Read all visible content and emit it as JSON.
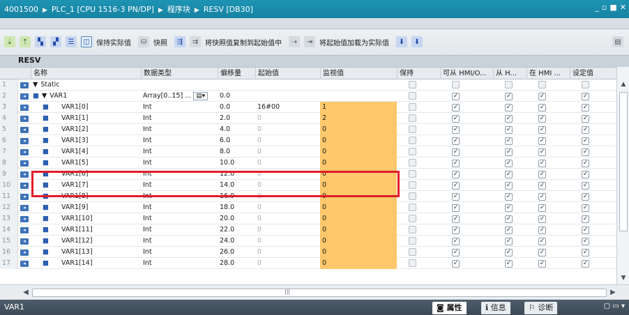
{
  "window": {
    "breadcrumb": [
      "4001500",
      "PLC_1 [CPU 1516-3 PN/DP]",
      "程序块",
      "RESV [DB30]"
    ],
    "controls": [
      "_",
      "▫",
      "■",
      "✕"
    ]
  },
  "toolbar": {
    "retain_label": "保持实际值",
    "snapshot_label": "快照",
    "copy_snapshot_label": "将快照值复制到起始值中",
    "load_start_label": "将起始值加载为实际值"
  },
  "block": {
    "name": "RESV"
  },
  "table": {
    "headers": [
      "名称",
      "数据类型",
      "偏移量",
      "起始值",
      "监视值",
      "保持",
      "可从 HMI/O...",
      "从 H...",
      "在 HMI ...",
      "设定值"
    ],
    "rows": [
      {
        "num": "1",
        "name": "Static",
        "type": "",
        "offset": "",
        "start": "",
        "monitor": "",
        "retain": false,
        "hmi1": false,
        "hmi2": false,
        "hmi3": false,
        "setpoint": false,
        "level": 0
      },
      {
        "num": "2",
        "name": "VAR1",
        "type": "Array[0..15] ...",
        "offset": "0.0",
        "start": "",
        "monitor": "",
        "retain": false,
        "hmi1": true,
        "hmi2": true,
        "hmi3": true,
        "setpoint": true,
        "level": 1
      },
      {
        "num": "3",
        "name": "VAR1[0]",
        "type": "Int",
        "offset": "0.0",
        "start": "16#00",
        "monitor": "1",
        "retain": false,
        "hmi1": true,
        "hmi2": true,
        "hmi3": true,
        "setpoint": true,
        "level": 2
      },
      {
        "num": "4",
        "name": "VAR1[1]",
        "type": "Int",
        "offset": "2.0",
        "start": "0",
        "monitor": "2",
        "retain": false,
        "hmi1": true,
        "hmi2": true,
        "hmi3": true,
        "setpoint": true,
        "level": 2
      },
      {
        "num": "5",
        "name": "VAR1[2]",
        "type": "Int",
        "offset": "4.0",
        "start": "0",
        "monitor": "0",
        "retain": false,
        "hmi1": true,
        "hmi2": true,
        "hmi3": true,
        "setpoint": true,
        "level": 2
      },
      {
        "num": "6",
        "name": "VAR1[3]",
        "type": "Int",
        "offset": "6.0",
        "start": "0",
        "monitor": "0",
        "retain": false,
        "hmi1": true,
        "hmi2": true,
        "hmi3": true,
        "setpoint": true,
        "level": 2
      },
      {
        "num": "7",
        "name": "VAR1[4]",
        "type": "Int",
        "offset": "8.0",
        "start": "0",
        "monitor": "0",
        "retain": false,
        "hmi1": true,
        "hmi2": true,
        "hmi3": true,
        "setpoint": true,
        "level": 2
      },
      {
        "num": "8",
        "name": "VAR1[5]",
        "type": "Int",
        "offset": "10.0",
        "start": "0",
        "monitor": "0",
        "retain": false,
        "hmi1": true,
        "hmi2": true,
        "hmi3": true,
        "setpoint": true,
        "level": 2
      },
      {
        "num": "9",
        "name": "VAR1[6]",
        "type": "Int",
        "offset": "12.0",
        "start": "0",
        "monitor": "0",
        "retain": false,
        "hmi1": true,
        "hmi2": true,
        "hmi3": true,
        "setpoint": true,
        "level": 2
      },
      {
        "num": "10",
        "name": "VAR1[7]",
        "type": "Int",
        "offset": "14.0",
        "start": "0",
        "monitor": "0",
        "retain": false,
        "hmi1": true,
        "hmi2": true,
        "hmi3": true,
        "setpoint": true,
        "level": 2
      },
      {
        "num": "11",
        "name": "VAR1[8]",
        "type": "Int",
        "offset": "16.0",
        "start": "0",
        "monitor": "0",
        "retain": false,
        "hmi1": true,
        "hmi2": true,
        "hmi3": true,
        "setpoint": true,
        "level": 2
      },
      {
        "num": "12",
        "name": "VAR1[9]",
        "type": "Int",
        "offset": "18.0",
        "start": "0",
        "monitor": "0",
        "retain": false,
        "hmi1": true,
        "hmi2": true,
        "hmi3": true,
        "setpoint": true,
        "level": 2
      },
      {
        "num": "13",
        "name": "VAR1[10]",
        "type": "Int",
        "offset": "20.0",
        "start": "0",
        "monitor": "0",
        "retain": false,
        "hmi1": true,
        "hmi2": true,
        "hmi3": true,
        "setpoint": true,
        "level": 2
      },
      {
        "num": "14",
        "name": "VAR1[11]",
        "type": "Int",
        "offset": "22.0",
        "start": "0",
        "monitor": "0",
        "retain": false,
        "hmi1": true,
        "hmi2": true,
        "hmi3": true,
        "setpoint": true,
        "level": 2
      },
      {
        "num": "15",
        "name": "VAR1[12]",
        "type": "Int",
        "offset": "24.0",
        "start": "0",
        "monitor": "0",
        "retain": false,
        "hmi1": true,
        "hmi2": true,
        "hmi3": true,
        "setpoint": true,
        "level": 2
      },
      {
        "num": "16",
        "name": "VAR1[13]",
        "type": "Int",
        "offset": "26.0",
        "start": "0",
        "monitor": "0",
        "retain": false,
        "hmi1": true,
        "hmi2": true,
        "hmi3": true,
        "setpoint": true,
        "level": 2
      },
      {
        "num": "17",
        "name": "VAR1[14]",
        "type": "Int",
        "offset": "28.0",
        "start": "0",
        "monitor": "0",
        "retain": false,
        "hmi1": true,
        "hmi2": true,
        "hmi3": true,
        "setpoint": true,
        "level": 2
      }
    ]
  },
  "status": {
    "selected": "VAR1",
    "tabs": [
      "属性",
      "信息",
      "诊断"
    ]
  },
  "colors": {
    "title_bg": "#1783a2",
    "monitor_highlight": "#ffc86b",
    "highlight_box": "#e21c2a",
    "status_bg": "#3d4a56"
  },
  "icons": {
    "toolbar": [
      "insert-row-icon",
      "add-row-icon",
      "expand-icon",
      "collapse-icon",
      "list-icon",
      "monitor-icon",
      "retain-icon",
      "snapshot-icon",
      "copy-icon",
      "load-icon"
    ]
  }
}
